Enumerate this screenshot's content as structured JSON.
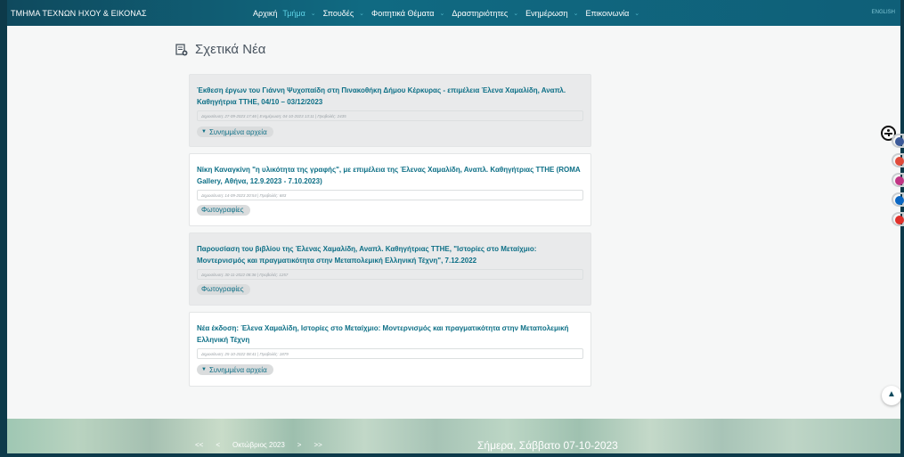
{
  "header": {
    "brand": "ΤΜΗΜΑ ΤΕΧΝΩΝ ΗΧΟΥ & ΕΙΚΟΝΑΣ",
    "menu": [
      {
        "label": "Αρχική",
        "active": false
      },
      {
        "label": "Τμήμα",
        "active": true
      },
      {
        "label": "Σπουδές",
        "active": false
      },
      {
        "label": "Φοιτητικά Θέματα",
        "active": false
      },
      {
        "label": "Δραστηριότητες",
        "active": false
      },
      {
        "label": "Ενημέρωση",
        "active": false
      },
      {
        "label": "Επικοινωνία",
        "active": false
      }
    ],
    "language": "ENGLISH"
  },
  "section": {
    "title": "Σχετικά Νέα",
    "icon": "news-icon"
  },
  "news": [
    {
      "title": "Έκθεση έργων του Γιάννη Ψυχοπαίδη στη Πινακοθήκη Δήμου Κέρκυρας - επιμέλεια Έλενα Χαμαλίδη, Αναπλ. Καθηγήτρια ΤΤΗΕ, 04/10 – 03/12/2023",
      "meta": "Δημοσίευση: 27-09-2023 17:46   |   Ενημέρωση: 04-10-2023 13:11   |   Προβολές: 2435",
      "action": "Συνημμένα αρχεία",
      "action_type": "attachments",
      "style": "grey"
    },
    {
      "title": "Νίκη Καναγκίνη \"η υλικότητα της γραφής\", με επιμέλεια της Έλενας Χαμαλίδη, Αναπλ. Καθηγήτριας ΤΤΗΕ (ROMA Gallery, Αθήνα, 12.9.2023 - 7.10.2023)",
      "meta": "Δημοσίευση: 14-09-2023 20:54   |   Προβολές: 683",
      "action": "Φωτογραφίες",
      "action_type": "photos",
      "style": "white"
    },
    {
      "title": "Παρουσίαση του βιβλίου της Έλενας Χαμαλίδη, Αναπλ. Καθηγήτριας ΤΤΗΕ, \"Ιστορίες στο Μεταίχμιο: Μοντερνισμός και πραγματικότητα στην Μεταπολεμική Ελληνική Τέχνη\", 7.12.2022",
      "meta": "Δημοσίευση: 30-11-2022 08:36   |   Προβολές: 1257",
      "action": "Φωτογραφίες",
      "action_type": "photos",
      "style": "grey"
    },
    {
      "title": "Νέα έκδοση: Έλενα Χαμαλίδη, Ιστορίες στο Μεταίχμιο: Μοντερνισμός και πραγματικότητα στην Μεταπολεμική Ελληνική Τέχνη",
      "meta": "Δημοσίευση: 25-10-2022 08:41   |   Προβολές: 1879",
      "action": "Συνημμένα αρχεία",
      "action_type": "attachments",
      "style": "white"
    }
  ],
  "social": [
    {
      "icon": "facebook-icon",
      "color": "#3b5998"
    },
    {
      "icon": "youtube-icon",
      "color": "#e04a3a"
    },
    {
      "icon": "instagram-icon",
      "color": "#c13584"
    },
    {
      "icon": "linkedin-icon",
      "color": "#0a66c2"
    },
    {
      "icon": "tiktok-icon",
      "color": "#e0302a"
    }
  ],
  "footer": {
    "pager": {
      "first": "<<",
      "prev": "<",
      "month": "Οκτώβριος 2023",
      "next": ">",
      "last": ">>"
    },
    "today": "Σήμερα, Σάββατο 07-10-2023"
  }
}
